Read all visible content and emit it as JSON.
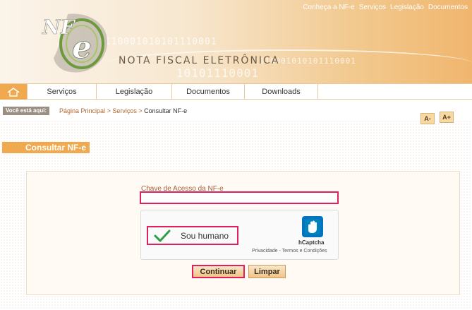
{
  "header": {
    "top_links": [
      "Conheça a NF-e",
      "Serviços",
      "Legislação",
      "Documentos"
    ],
    "brand_title": "NOTA FISCAL ELETRÔNICA",
    "logo_text": "NF",
    "logo_e": "e",
    "binary_1": "0110001010101110001",
    "binary_2": "1110001010101110001",
    "binary_3": "10101110001"
  },
  "nav": {
    "home_icon": "home-icon",
    "tabs": [
      "Serviços",
      "Legislação",
      "Documentos",
      "Downloads"
    ]
  },
  "breadcrumb": {
    "label": "Você está aqui:",
    "items": [
      "Página Principal",
      "Serviços"
    ],
    "separator": ">",
    "current": "Consultar NF-e"
  },
  "font_controls": {
    "decrease": "A-",
    "increase": "A+"
  },
  "section": {
    "title": "Consultar NF-e"
  },
  "form": {
    "key_label": "Chave de Acesso da NF-e",
    "key_value": "",
    "captcha": {
      "checkbox_label": "Sou humano",
      "checked": true,
      "brand": "hCaptcha",
      "links": "Privacidade - Termos e Condições"
    },
    "continue_label": "Continuar",
    "clear_label": "Limpar"
  },
  "colors": {
    "accent_orange": "#f0a94e",
    "link_brown": "#b3652c",
    "highlight": "#e0205a",
    "check_green": "#2f9e44"
  }
}
